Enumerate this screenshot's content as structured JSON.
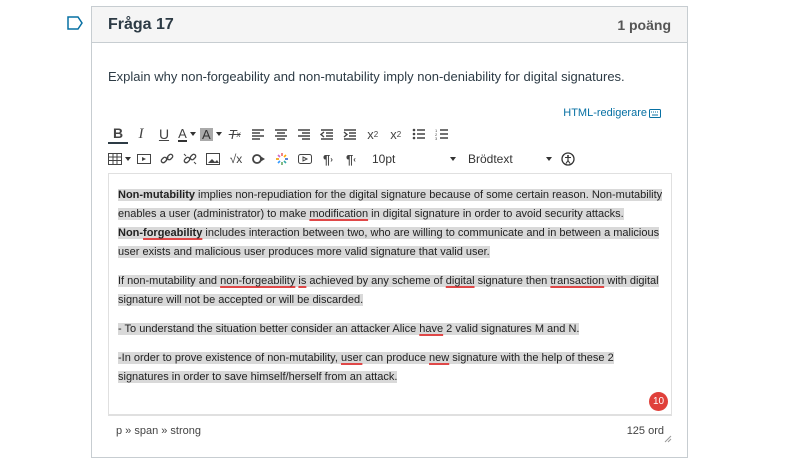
{
  "question": {
    "title": "Fråga 17",
    "points": "1 poäng",
    "text": "Explain why non-forgeability and non-mutability imply non-deniability for digital signatures."
  },
  "editor_link": "HTML-redigerare",
  "toolbar": {
    "font_size": "10pt",
    "block_format": "Brödtext"
  },
  "content": {
    "p1": {
      "b1": "Non-mutability",
      "t1": " implies non-repudiation for the digital signature because of some certain reason. Non-mutability enables a user (administrator) to make ",
      "u1": "modification",
      "t2": " in digital signature in order to avoid security attacks.",
      "b2a": "Non-",
      "b2u": "forgeability",
      "t3": " includes interaction between two, who are willing to communicate and in between a malicious user exists and malicious user produces more valid signature that valid user."
    },
    "p2": {
      "t1": "If non-mutability and ",
      "u1": "non-forgeability",
      "t2": " ",
      "u2": "is",
      "t3": " achieved by any scheme of ",
      "u3": "digital",
      "t4": " signature then ",
      "u4": "transaction",
      "t5": " with digital signature will not be accepted or will be discarded."
    },
    "p3": {
      "t1": "- To understand the situation better consider an attacker Alice ",
      "u1": "have",
      "t2": " 2 valid signatures M and N."
    },
    "p4": {
      "t1": "-In order to prove existence of non-mutability, ",
      "u1": "user",
      "t2": " can produce ",
      "u2": "new",
      "t3": " signature with the help of these 2 signatures in order to save himself/herself from an attack."
    }
  },
  "badge_count": "10",
  "status": {
    "path": "p » span » strong",
    "word_count": "125 ord"
  },
  "colors": {
    "header_bg": "#f5f5f5",
    "link": "#0770a3",
    "highlight": "#d9d9d9",
    "spell_underline": "#e04848",
    "badge": "#e0403a"
  }
}
